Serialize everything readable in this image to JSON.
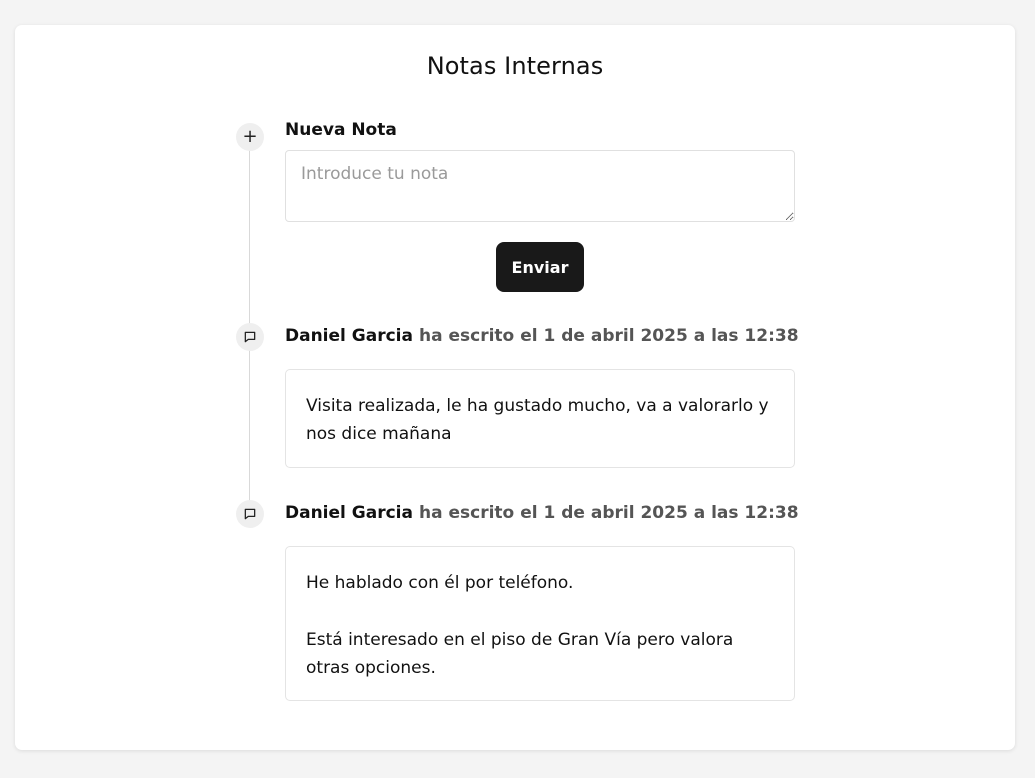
{
  "page": {
    "title": "Notas Internas"
  },
  "new_note": {
    "label": "Nueva Nota",
    "placeholder": "Introduce tu nota",
    "value": "",
    "submit_label": "Enviar"
  },
  "notes": [
    {
      "author": "Daniel Garcia",
      "action": "ha escrito",
      "date": "el 1 de abril 2025 a las 12:38",
      "paragraphs": [
        "Visita realizada, le ha gustado mucho, va a valorarlo y nos dice mañana"
      ]
    },
    {
      "author": "Daniel Garcia",
      "action": "ha escrito",
      "date": "el 1 de abril 2025 a las 12:38",
      "paragraphs": [
        "He hablado con él por teléfono.",
        "Está interesado en el piso de Gran Vía pero valora otras opciones."
      ]
    }
  ],
  "icons": {
    "add": "plus-icon",
    "note": "message-square-icon"
  },
  "colors": {
    "button_bg": "#191919",
    "button_text": "#ffffff",
    "meta_text": "#555555",
    "timeline": "#d9d9d9"
  }
}
